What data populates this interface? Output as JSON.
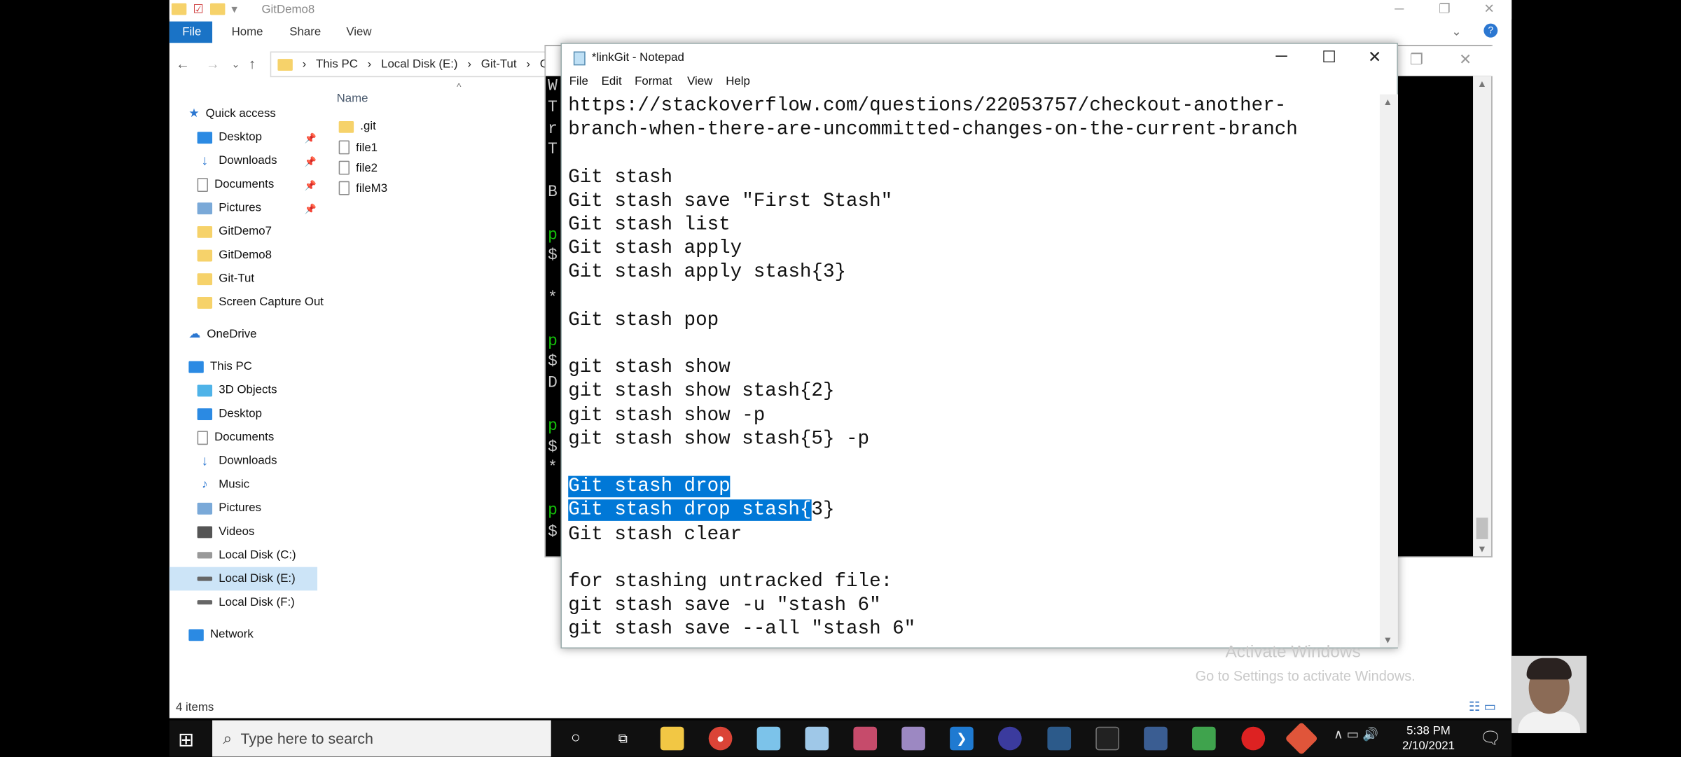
{
  "explorer": {
    "title": "GitDemo8",
    "tabs": {
      "file": "File",
      "home": "Home",
      "share": "Share",
      "view": "View"
    },
    "breadcrumb": [
      "This PC",
      "Local Disk (E:)",
      "Git-Tut",
      "GitD"
    ],
    "column_name": "Name",
    "nav": {
      "quick_access": "Quick access",
      "desktop": "Desktop",
      "downloads": "Downloads",
      "documents": "Documents",
      "pictures": "Pictures",
      "gitdemo7": "GitDemo7",
      "gitdemo8": "GitDemo8",
      "git_tut": "Git-Tut",
      "screen_capture": "Screen Capture Out",
      "onedrive": "OneDrive",
      "this_pc": "This PC",
      "objects3d": "3D Objects",
      "desktop2": "Desktop",
      "documents2": "Documents",
      "downloads2": "Downloads",
      "music": "Music",
      "pictures2": "Pictures",
      "videos": "Videos",
      "disk_c": "Local Disk (C:)",
      "disk_e": "Local Disk (E:)",
      "disk_f": "Local Disk (F:)",
      "network": "Network"
    },
    "files": [
      ".git",
      "file1",
      "file2",
      "fileM3"
    ],
    "status": "4 items"
  },
  "cmd": {
    "lines": [
      {
        "t": "W",
        "c": "w"
      },
      {
        "t": "T",
        "c": "w"
      },
      {
        "t": "r",
        "c": "w"
      },
      {
        "t": "T",
        "c": "w"
      },
      {
        "t": "",
        "c": "w"
      },
      {
        "t": "B",
        "c": "w"
      },
      {
        "t": "",
        "c": "w"
      },
      {
        "t": "p",
        "c": "g"
      },
      {
        "t": "$",
        "c": "w"
      },
      {
        "t": "",
        "c": "w"
      },
      {
        "t": "*",
        "c": "w"
      },
      {
        "t": "",
        "c": "w"
      },
      {
        "t": "p",
        "c": "g"
      },
      {
        "t": "$",
        "c": "w"
      },
      {
        "t": "D",
        "c": "w"
      },
      {
        "t": "",
        "c": "w"
      },
      {
        "t": "p",
        "c": "g"
      },
      {
        "t": "$",
        "c": "w"
      },
      {
        "t": "*",
        "c": "w"
      },
      {
        "t": "",
        "c": "w"
      },
      {
        "t": "p",
        "c": "g"
      },
      {
        "t": "$",
        "c": "w"
      }
    ]
  },
  "notepad": {
    "title": "*linkGit - Notepad",
    "menu": {
      "file": "File",
      "edit": "Edit",
      "format": "Format",
      "view": "View",
      "help": "Help"
    },
    "lines": [
      "https://stackoverflow.com/questions/22053757/checkout-another-",
      "branch-when-there-are-uncommitted-changes-on-the-current-branch",
      "",
      "Git stash",
      "Git stash save \"First Stash\"",
      "Git stash list",
      "Git stash apply",
      "Git stash apply stash{3}",
      "",
      "Git stash pop",
      "",
      "git stash show",
      "git stash show stash{2}",
      "git stash show -p",
      "git stash show stash{5} -p",
      "",
      "Git stash drop",
      "Git stash drop stash{3}",
      "Git stash clear",
      "",
      "for stashing untracked file:",
      "git stash save -u \"stash 6\"",
      "git stash save --all \"stash 6\""
    ],
    "selected_1": "Git stash drop",
    "selected_2": "Git stash drop stash{",
    "rest_2": "3}"
  },
  "watermark": {
    "line1": "Activate Windows",
    "line2": "Go to Settings to activate Windows."
  },
  "taskbar": {
    "search_placeholder": "Type here to search",
    "time": "5:38 PM",
    "date": "2/10/2021",
    "apps": [
      "cortana-icon",
      "task-view-icon",
      "file-explorer-icon",
      "chrome-icon",
      "notepad-icon",
      "paint-icon",
      "pdf-icon",
      "photos-icon",
      "vscode-icon",
      "eclipse-icon",
      "mysql-icon",
      "cmd-icon",
      "screenshot-icon",
      "camtasia-icon",
      "recorder-icon",
      "git-icon"
    ]
  },
  "colors": {
    "accent": "#0078d7",
    "file_tab": "#1a73c6",
    "taskbar": "#101010",
    "prompt_green": "#16c60c"
  }
}
